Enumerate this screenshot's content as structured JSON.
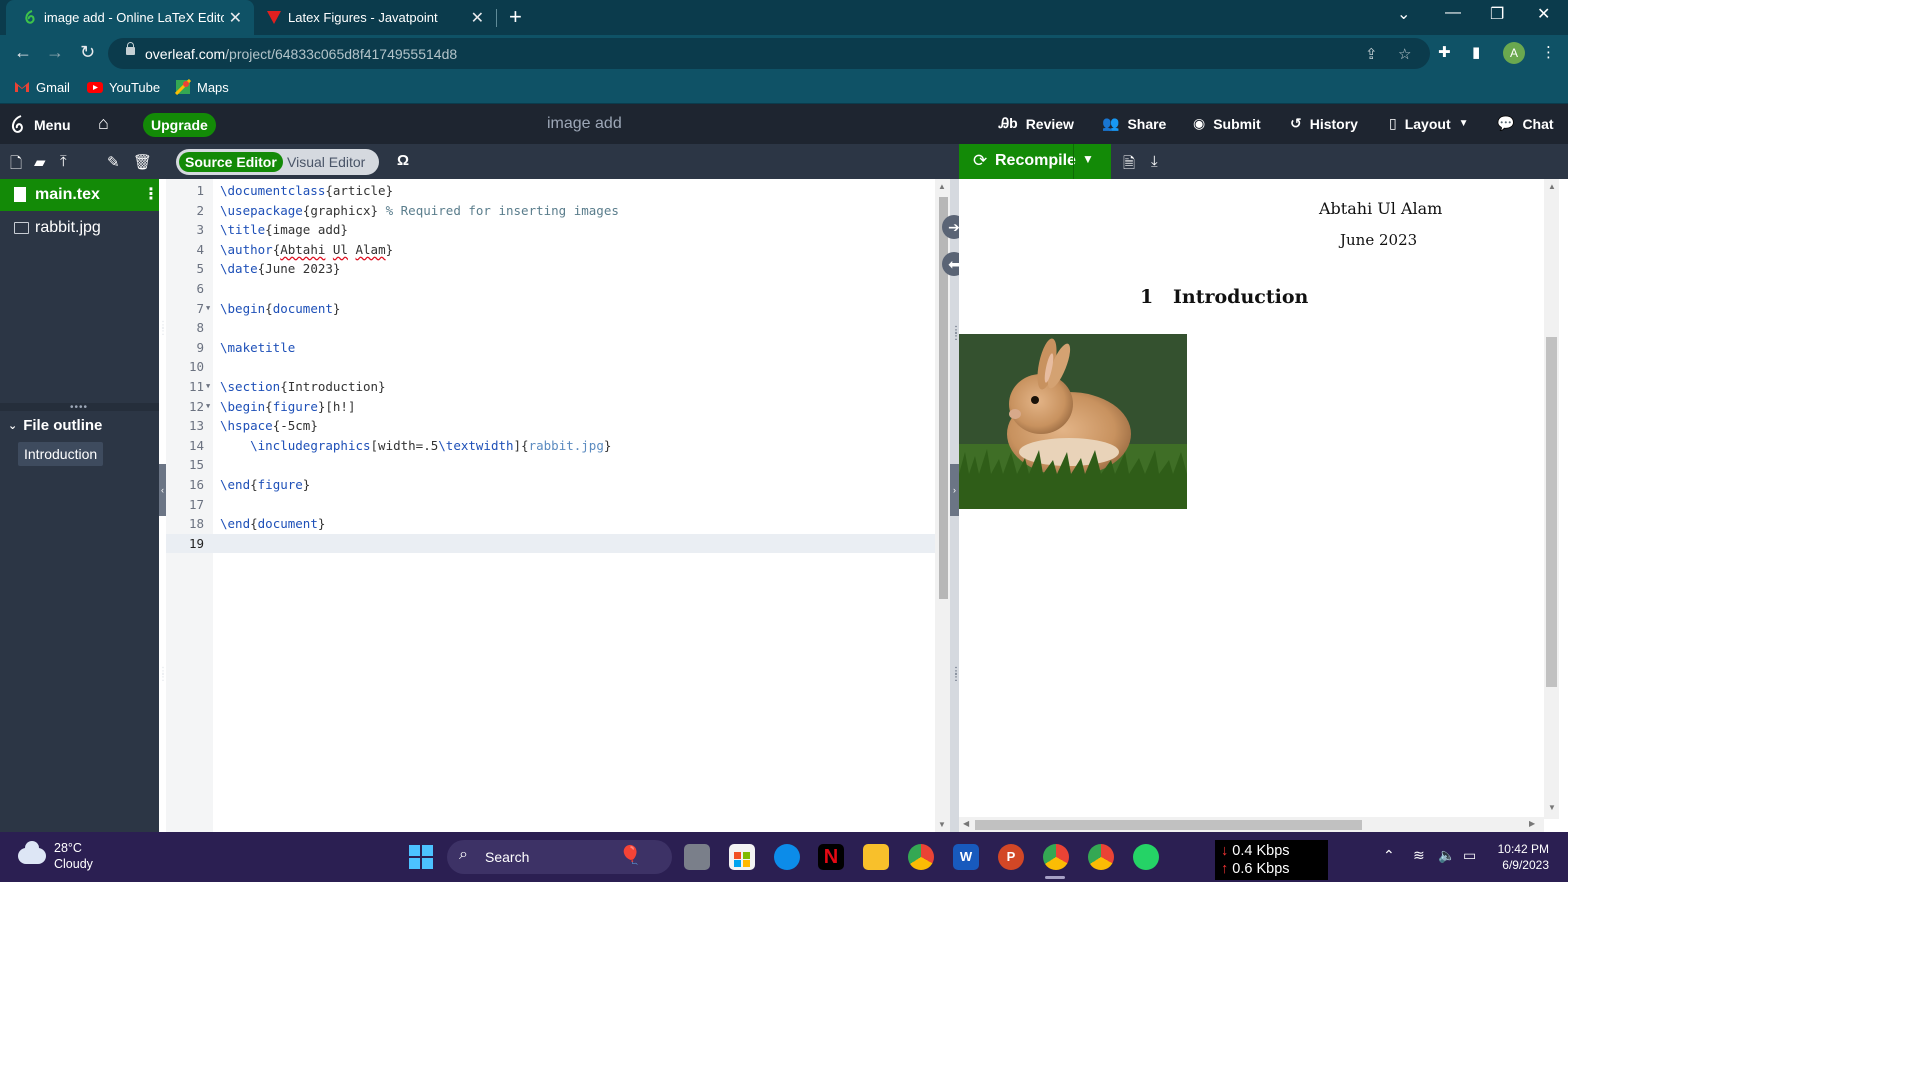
{
  "browser": {
    "tabs": [
      {
        "label": "image add - Online LaTeX Editor",
        "active": true
      },
      {
        "label": "Latex Figures - Javatpoint",
        "active": false
      }
    ],
    "url_host": "overleaf.com",
    "url_path": "/project/64833c065d8f4174955514d8",
    "bookmarks": [
      {
        "label": "Gmail",
        "icon": "gmail-icon"
      },
      {
        "label": "YouTube",
        "icon": "youtube-icon"
      },
      {
        "label": "Maps",
        "icon": "maps-icon"
      }
    ],
    "profile_initial": "A"
  },
  "overleaf": {
    "menu_label": "Menu",
    "upgrade_label": "Upgrade",
    "project_title": "image add",
    "toolbar": {
      "review": "Review",
      "share": "Share",
      "submit": "Submit",
      "history": "History",
      "layout": "Layout",
      "chat": "Chat"
    },
    "editor_modes": {
      "source": "Source Editor",
      "visual": "Visual Editor"
    },
    "omega": "Ω",
    "recompile": "Recompile",
    "files": [
      {
        "name": "main.tex",
        "active": true
      },
      {
        "name": "rabbit.jpg",
        "active": false
      }
    ],
    "file_outline_label": "File outline",
    "outline_items": [
      "Introduction"
    ],
    "code_lines": [
      "\\documentclass{article}",
      "\\usepackage{graphicx} % Required for inserting images",
      "\\title{image add}",
      "\\author{Abtahi Ul Alam}",
      "\\date{June 2023}",
      "",
      "\\begin{document}",
      "",
      "\\maketitle",
      "",
      "\\section{Introduction}",
      "\\begin{figure}[h!]",
      "\\hspace{-5cm}",
      "    \\includegraphics[width=.5\\textwidth]{rabbit.jpg}",
      "",
      "\\end{figure}",
      "",
      "\\end{document}",
      ""
    ],
    "current_line": 19
  },
  "pdf": {
    "author": "Abtahi Ul Alam",
    "date": "June 2023",
    "section_number": "1",
    "section_title": "Introduction"
  },
  "taskbar": {
    "temperature": "28°C",
    "weather": "Cloudy",
    "search": "Search",
    "net_down": "0.4 Kbps",
    "net_up": "0.6 Kbps",
    "time": "10:42 PM",
    "date": "6/9/2023"
  },
  "colors": {
    "overleaf_green": "#138a07",
    "overleaf_dark": "#1e2530",
    "chrome_tab": "#0f5266"
  }
}
